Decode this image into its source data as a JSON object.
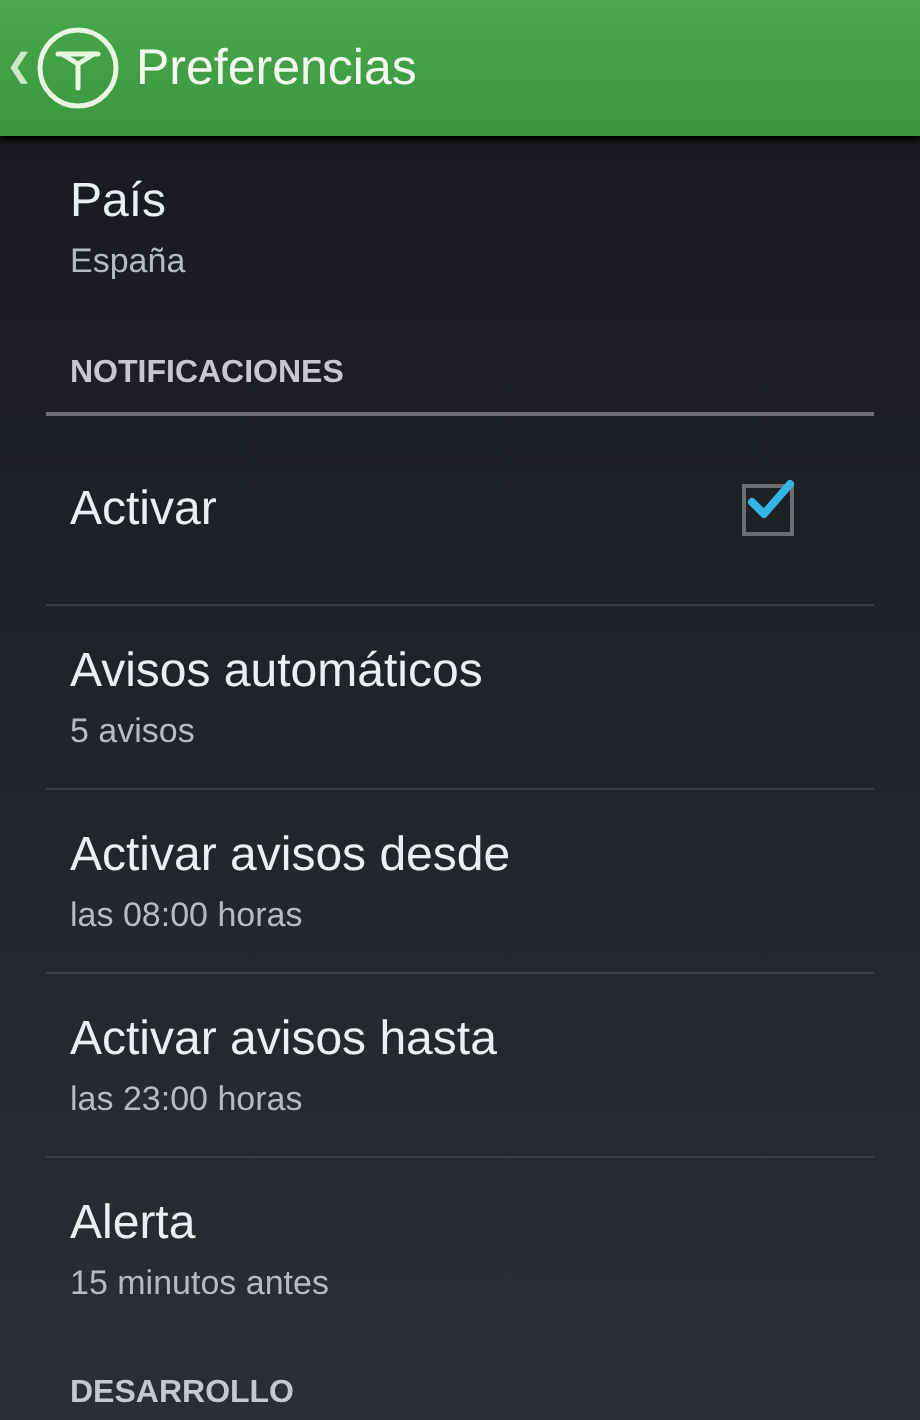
{
  "action_bar": {
    "back": "❮",
    "title": "Preferencias"
  },
  "sections": [
    {
      "items": [
        {
          "kind": "text",
          "title": "País",
          "summary": "España"
        }
      ]
    },
    {
      "header": "NOTIFICACIONES",
      "items": [
        {
          "kind": "checkbox",
          "title": "Activar",
          "checked": true
        },
        {
          "kind": "text",
          "title": "Avisos automáticos",
          "summary": "5 avisos"
        },
        {
          "kind": "text",
          "title": "Activar avisos desde",
          "summary": "las 08:00 horas"
        },
        {
          "kind": "text",
          "title": "Activar avisos hasta",
          "summary": "las 23:00 horas"
        },
        {
          "kind": "text",
          "title": "Alerta",
          "summary": "15 minutos antes"
        }
      ]
    },
    {
      "header": "DESARROLLO"
    }
  ]
}
